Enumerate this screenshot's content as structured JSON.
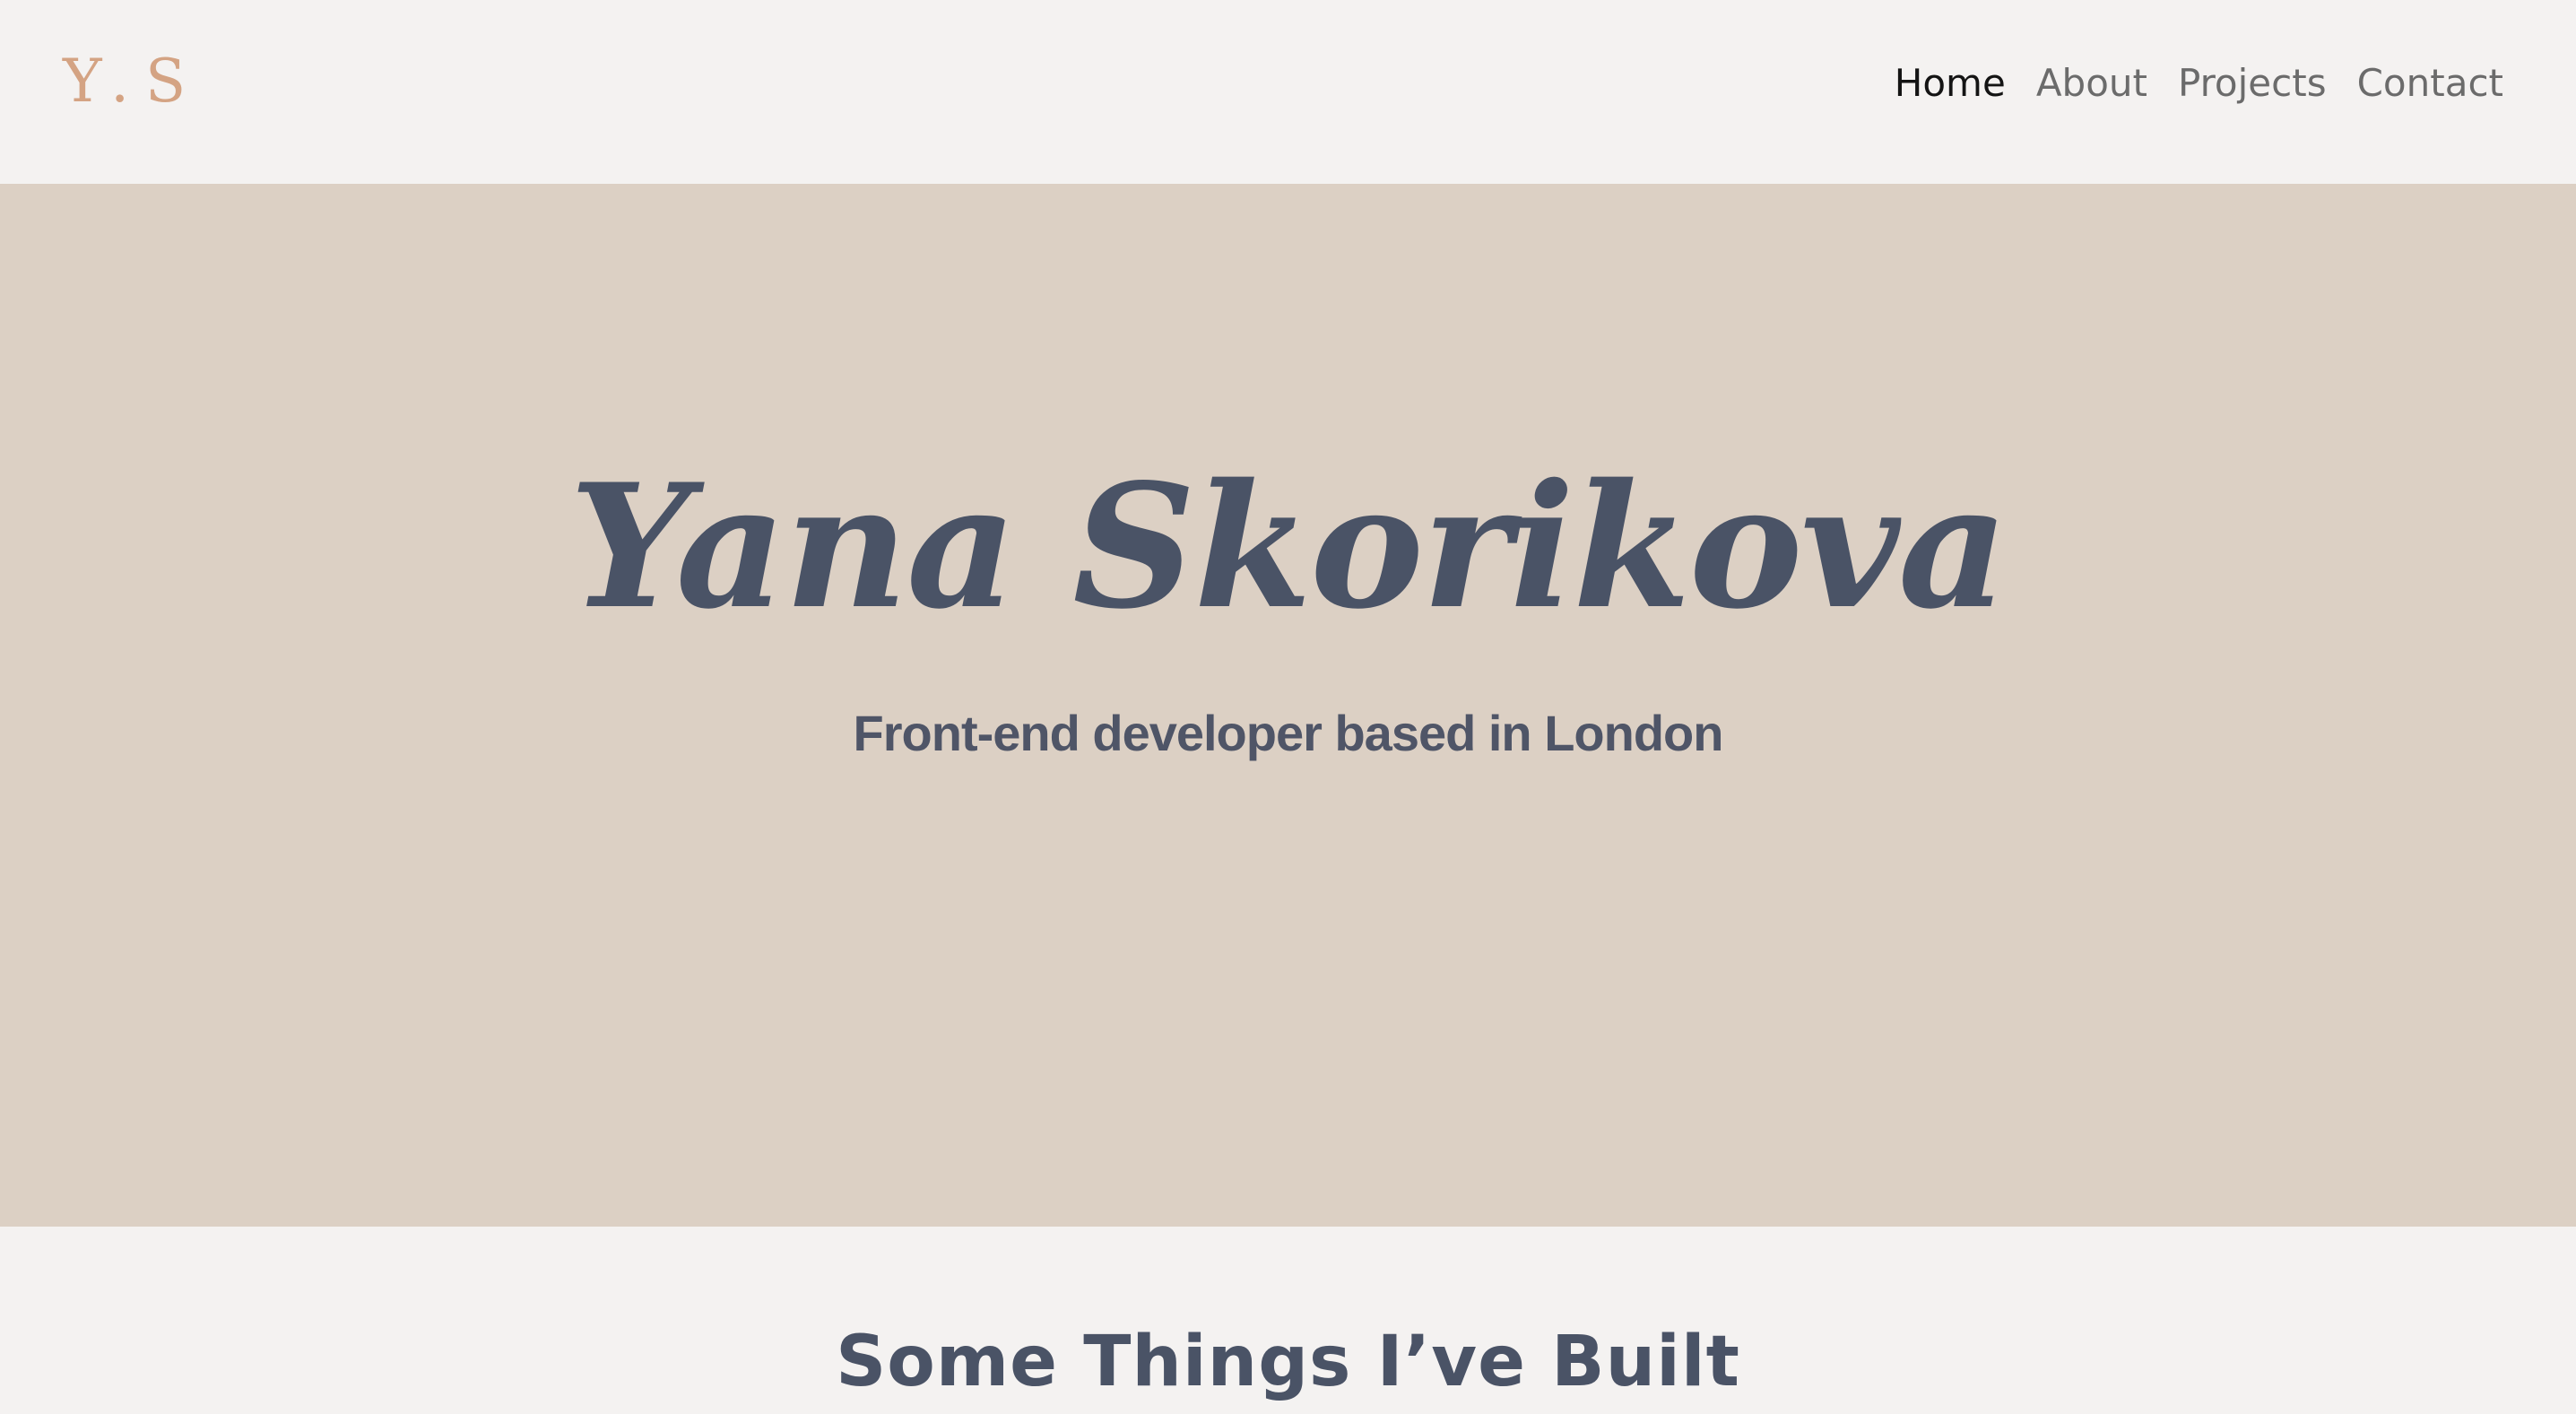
{
  "header": {
    "logo": "Y.S",
    "nav": [
      {
        "label": "Home",
        "active": true
      },
      {
        "label": "About",
        "active": false
      },
      {
        "label": "Projects",
        "active": false
      },
      {
        "label": "Contact",
        "active": false
      }
    ]
  },
  "hero": {
    "name": "Yana Skorikova",
    "subtitle": "Front-end developer based in London"
  },
  "projects": {
    "title": "Some Things I’ve Built"
  },
  "colors": {
    "page_background": "#f4f2f1",
    "hero_background": "#dcd0c4",
    "logo": "#d4a383",
    "heading": "#4a5366",
    "nav_active": "#141414",
    "nav_inactive": "#6b6b6b"
  }
}
